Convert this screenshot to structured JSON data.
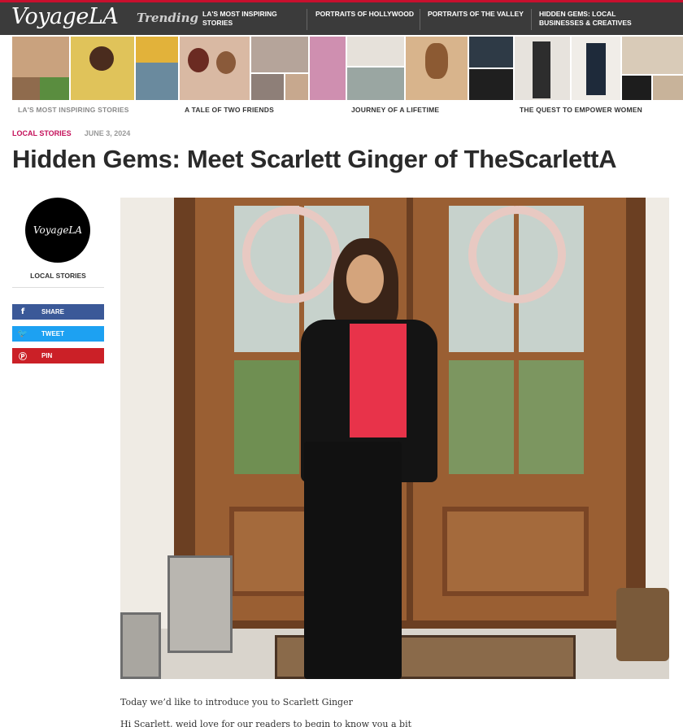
{
  "site": {
    "logo": "VoyageLA",
    "trending_label": "Trending"
  },
  "trending_nav": [
    "LA's Most Inspiring Stories",
    "Portraits of Hollywood",
    "Portraits of the Valley",
    "Hidden Gems: Local Businesses & Creatives"
  ],
  "story_captions": [
    "LA's Most Inspiring Stories",
    "A Tale of Two Friends",
    "Journey of a Lifetime",
    "The Quest to Empower Women"
  ],
  "article": {
    "category": "Local Stories",
    "date": "June 3, 2024",
    "headline": "Hidden Gems: Meet Scarlett Ginger of TheScarlettA",
    "intro": "Today we’d like to introduce you to Scarlett Ginger",
    "next_line": "Hi Scarlett, weid love for our readers to begin to know you a bit"
  },
  "sidebar": {
    "badge_logo": "VoyageLA",
    "badge_label": "Local Stories",
    "share": [
      {
        "icon": "facebook-icon",
        "label": "Share",
        "color": "#3b5998"
      },
      {
        "icon": "twitter-icon",
        "label": "Tweet",
        "color": "#1da1f2"
      },
      {
        "icon": "pinterest-icon",
        "label": "Pin",
        "color": "#cb2027"
      }
    ]
  },
  "colors": {
    "brand_red": "#c8102e",
    "category_pink": "#c4105a",
    "topbar": "#3b3b3b"
  }
}
